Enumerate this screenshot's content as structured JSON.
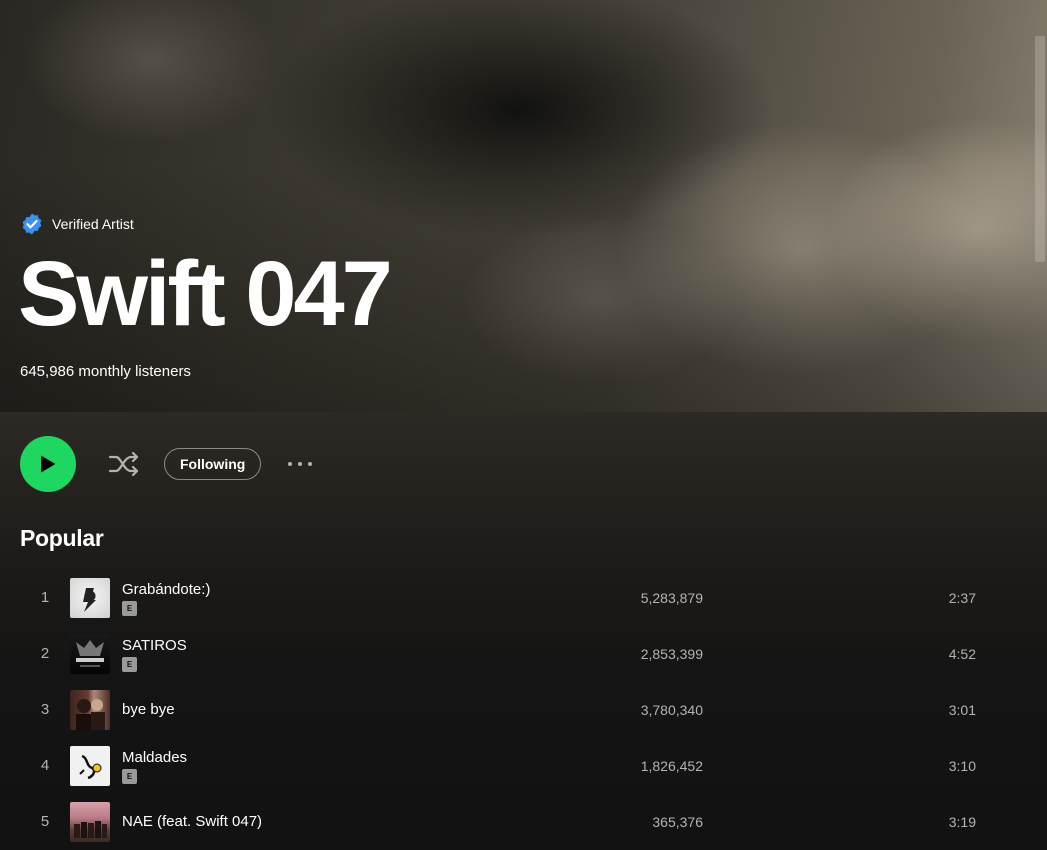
{
  "artist": {
    "verified_label": "Verified Artist",
    "name": "Swift 047",
    "monthly_listeners": "645,986 monthly listeners"
  },
  "actions": {
    "play_icon": "play-icon",
    "shuffle_icon": "shuffle-icon",
    "following_label": "Following",
    "more_icon": "more-options-icon"
  },
  "popular": {
    "title": "Popular",
    "tracks": [
      {
        "num": "1",
        "title": "Grabándote:)",
        "explicit": "E",
        "plays": "5,283,879",
        "duration": "2:37"
      },
      {
        "num": "2",
        "title": "SATIROS",
        "explicit": "E",
        "plays": "2,853,399",
        "duration": "4:52"
      },
      {
        "num": "3",
        "title": "bye bye",
        "explicit": "",
        "plays": "3,780,340",
        "duration": "3:01"
      },
      {
        "num": "4",
        "title": "Maldades",
        "explicit": "E",
        "plays": "1,826,452",
        "duration": "3:10"
      },
      {
        "num": "5",
        "title": "NAE (feat. Swift 047)",
        "explicit": "",
        "plays": "365,376",
        "duration": "3:19"
      }
    ]
  },
  "colors": {
    "accent": "#1ed760",
    "verified": "#3d91f4",
    "background": "#121212"
  }
}
